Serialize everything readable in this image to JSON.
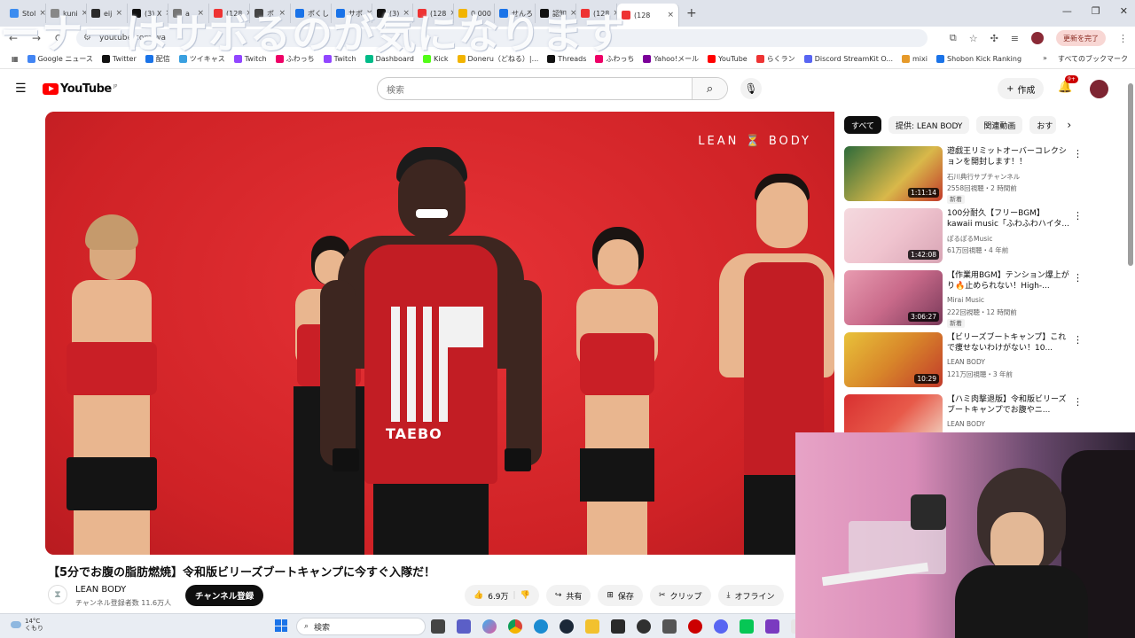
{
  "overlay_caption": "ーナーはサボるのが気になります",
  "browser": {
    "tabs": [
      {
        "label": "Stol"
      },
      {
        "label": "kuni"
      },
      {
        "label": "eij"
      },
      {
        "label": "(3) X"
      },
      {
        "label": "a"
      },
      {
        "label": "(128"
      },
      {
        "label": "ポ"
      },
      {
        "label": "ポくし"
      },
      {
        "label": "サポ"
      },
      {
        "label": "(3)"
      },
      {
        "label": "(128"
      },
      {
        "label": "0.000"
      },
      {
        "label": "せんろ"
      },
      {
        "label": "認知"
      },
      {
        "label": "(128"
      },
      {
        "label": "(128"
      }
    ],
    "new_tab": "+",
    "url": "youtube.com/wa",
    "update_label": "更新を完了",
    "bookmarks": [
      "Google ニュース",
      "Twitter",
      "配信",
      "ツイキャス",
      "Twitch",
      "ふわっち",
      "Twitch",
      "Dashboard",
      "Kick",
      "Doneru（どねる）|...",
      "Threads",
      "ふわっち",
      "Yahoo!メール",
      "YouTube",
      "らくラン",
      "Discord StreamKit O...",
      "mixi",
      "Shobon Kick Ranking"
    ],
    "all_bookmarks": "すべてのブックマーク"
  },
  "youtube": {
    "logo_text": "YouTube",
    "logo_suffix": "JP",
    "search_placeholder": "検索",
    "create_label": "作成",
    "notification_count": "9+"
  },
  "video": {
    "watermark": "LEAN ⏳ BODY",
    "shirt_text": "TAEBO",
    "title": "【5分でお腹の脂肪燃焼】令和版ビリーズブートキャンプに今すぐ入隊だ！",
    "channel": "LEAN BODY",
    "subscribers": "チャンネル登録者数 11.6万人",
    "subscribe_label": "チャンネル登録",
    "likes": "6.9万",
    "share": "共有",
    "save": "保存",
    "clip": "クリップ",
    "offline": "オフライン"
  },
  "chips": [
    "すべて",
    "提供: LEAN BODY",
    "関連動画",
    "おす"
  ],
  "recommendations": [
    {
      "title": "遊戯王リミットオーバーコレクションを開封します！！",
      "channel": "石川典行サブチャンネル",
      "meta": "2558回視聴・2 時間前",
      "badge": "新着",
      "duration": "1:11:14"
    },
    {
      "title": "100分耐久【フリーBGM】kawaii music「ふわふわハイタ...",
      "channel": "ぽるぽるMusic",
      "meta": "61万回視聴・4 年前",
      "badge": "",
      "duration": "1:42:08"
    },
    {
      "title": "【作業用BGM】テンション爆上がり🔥止められない！High-...",
      "channel": "Mirai Music",
      "meta": "222回視聴・12 時間前",
      "badge": "新着",
      "duration": "3:06:27"
    },
    {
      "title": "【ビリーズブートキャンプ】これで痩せないわけがない！10...",
      "channel": "LEAN BODY",
      "meta": "121万回視聴・3 年前",
      "badge": "",
      "duration": "10:29"
    },
    {
      "title": "【ハミ肉撃退版】令和版ビリーズブートキャンプでお腹やニ...",
      "channel": "LEAN BODY",
      "meta": "",
      "badge": "",
      "duration": ""
    }
  ],
  "taskbar": {
    "temperature": "14°C",
    "weather": "くもり",
    "search_label": "検索"
  },
  "colors": {
    "yt_red": "#ff0000",
    "video_bg": "#d8292d",
    "subscribe_bg": "#0f0f0f"
  }
}
